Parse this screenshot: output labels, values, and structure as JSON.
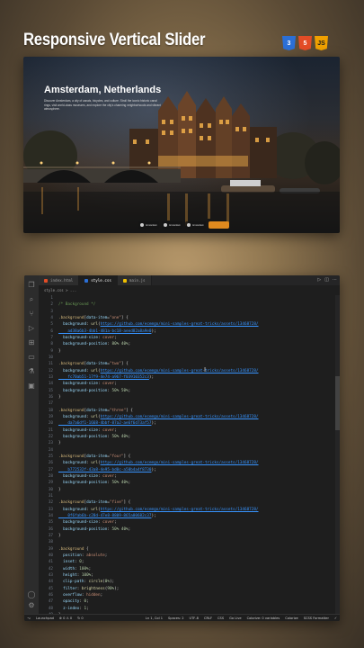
{
  "header": {
    "title": "Responsive Vertical Slider",
    "badges": [
      {
        "label": "3",
        "icon": "css3-logo-icon",
        "color": "#2b6fd6"
      },
      {
        "label": "5",
        "icon": "html5-logo-icon",
        "color": "#e34c26"
      },
      {
        "label": "JS",
        "icon": "javascript-logo-icon",
        "color": "#f0a000"
      }
    ]
  },
  "preview": {
    "title": "Amsterdam, Netherlands",
    "description": "Discover Amsterdam, a city of canals, bicycles, and culture. Stroll the iconic historic canal rings, visit world-class museums, and explore the city's charming neighborhoods and vibrant atmosphere.",
    "thumbs": [
      {
        "label": "Amsterdam"
      },
      {
        "label": "Amsterdam"
      },
      {
        "label": "Amsterdam"
      },
      {
        "label": ""
      }
    ]
  },
  "editor": {
    "tabs": [
      {
        "label": "index.html",
        "color": "#e34c26",
        "active": false
      },
      {
        "label": "style.css",
        "color": "#2b6fd6",
        "active": true
      },
      {
        "label": "main.js",
        "color": "#f0c000",
        "active": false
      }
    ],
    "breadcrumb": "style.css > ...",
    "start_line": 1,
    "lines": [
      [],
      [
        [
          "c-comment",
          "/* Background */"
        ]
      ],
      [],
      [
        [
          "c-sel",
          ".background"
        ],
        [
          "c-brace",
          "["
        ],
        [
          "c-attr",
          "data-item"
        ],
        [
          "c-brace",
          "="
        ],
        [
          "c-str",
          "\"one\""
        ],
        [
          "c-brace",
          "] {"
        ]
      ],
      [
        [
          "c-prop",
          "  background"
        ],
        [
          "txt",
          ": "
        ],
        [
          "c-fn",
          "url"
        ],
        [
          "txt",
          "("
        ],
        [
          "c-link",
          "https://github.com/ecemgo/mini-samples-great-tricks/assets/13468728/"
        ]
      ],
      [
        [
          "c-link",
          "    ad38a6b3-4bb1-481a-bc18-aeed82a8a9e0"
        ],
        [
          "txt",
          ");"
        ]
      ],
      [
        [
          "c-prop",
          "  background-size"
        ],
        [
          "txt",
          ": "
        ],
        [
          "c-val",
          "cover"
        ],
        [
          "txt",
          ";"
        ]
      ],
      [
        [
          "c-prop",
          "  background-position"
        ],
        [
          "txt",
          ": "
        ],
        [
          "c-num",
          "80% 40%"
        ],
        [
          "txt",
          ";"
        ]
      ],
      [
        [
          "c-brace",
          "}"
        ]
      ],
      [],
      [
        [
          "c-sel",
          ".background"
        ],
        [
          "c-brace",
          "["
        ],
        [
          "c-attr",
          "data-item"
        ],
        [
          "c-brace",
          "="
        ],
        [
          "c-str",
          "\"two\""
        ],
        [
          "c-brace",
          "] {"
        ]
      ],
      [
        [
          "c-prop",
          "  background"
        ],
        [
          "txt",
          ": "
        ],
        [
          "c-fn",
          "url"
        ],
        [
          "txt",
          "("
        ],
        [
          "c-link",
          "https://github.com/ecemgo/mini-samples-great-tricks/assets/13468728/"
        ]
      ],
      [
        [
          "c-link",
          "    fc70ab51-17f9-4e74-a967-f03910352c3"
        ],
        [
          "txt",
          ");"
        ]
      ],
      [
        [
          "c-prop",
          "  background-size"
        ],
        [
          "txt",
          ": "
        ],
        [
          "c-val",
          "cover"
        ],
        [
          "txt",
          ";"
        ]
      ],
      [
        [
          "c-prop",
          "  background-position"
        ],
        [
          "txt",
          ": "
        ],
        [
          "c-num",
          "50% 50%"
        ],
        [
          "txt",
          ";"
        ]
      ],
      [
        [
          "c-brace",
          "}"
        ]
      ],
      [],
      [
        [
          "c-sel",
          ".background"
        ],
        [
          "c-brace",
          "["
        ],
        [
          "c-attr",
          "data-item"
        ],
        [
          "c-brace",
          "="
        ],
        [
          "c-str",
          "\"three\""
        ],
        [
          "c-brace",
          "] {"
        ]
      ],
      [
        [
          "c-prop",
          "  background"
        ],
        [
          "txt",
          ": "
        ],
        [
          "c-fn",
          "url"
        ],
        [
          "txt",
          "("
        ],
        [
          "c-link",
          "https://github.com/ecemgo/mini-samples-great-tricks/assets/13468728/"
        ]
      ],
      [
        [
          "c-link",
          "    da7a6df1-1668-4bbf-87a2-ae6f6d73af57"
        ],
        [
          "txt",
          ");"
        ]
      ],
      [
        [
          "c-prop",
          "  background-size"
        ],
        [
          "txt",
          ": "
        ],
        [
          "c-val",
          "cover"
        ],
        [
          "txt",
          ";"
        ]
      ],
      [
        [
          "c-prop",
          "  background-position"
        ],
        [
          "txt",
          ": "
        ],
        [
          "c-num",
          "50% 40%"
        ],
        [
          "txt",
          ";"
        ]
      ],
      [
        [
          "c-brace",
          "}"
        ]
      ],
      [],
      [
        [
          "c-sel",
          ".background"
        ],
        [
          "c-brace",
          "["
        ],
        [
          "c-attr",
          "data-item"
        ],
        [
          "c-brace",
          "="
        ],
        [
          "c-str",
          "\"four\""
        ],
        [
          "c-brace",
          "] {"
        ]
      ],
      [
        [
          "c-prop",
          "  background"
        ],
        [
          "txt",
          ": "
        ],
        [
          "c-fn",
          "url"
        ],
        [
          "txt",
          "("
        ],
        [
          "c-link",
          "https://github.com/ecemgo/mini-samples-great-tricks/assets/13468728/"
        ]
      ],
      [
        [
          "c-link",
          "    b772532f-43a8-4e95-bd0c-a50b4a4f8730"
        ],
        [
          "txt",
          ");"
        ]
      ],
      [
        [
          "c-prop",
          "  background-size"
        ],
        [
          "txt",
          ": "
        ],
        [
          "c-val",
          "cover"
        ],
        [
          "txt",
          ";"
        ]
      ],
      [
        [
          "c-prop",
          "  background-position"
        ],
        [
          "txt",
          ": "
        ],
        [
          "c-num",
          "50% 40%"
        ],
        [
          "txt",
          ";"
        ]
      ],
      [
        [
          "c-brace",
          "}"
        ]
      ],
      [],
      [
        [
          "c-sel",
          ".background"
        ],
        [
          "c-brace",
          "["
        ],
        [
          "c-attr",
          "data-item"
        ],
        [
          "c-brace",
          "="
        ],
        [
          "c-str",
          "\"five\""
        ],
        [
          "c-brace",
          "] {"
        ]
      ],
      [
        [
          "c-prop",
          "  background"
        ],
        [
          "txt",
          ": "
        ],
        [
          "c-fn",
          "url"
        ],
        [
          "txt",
          "("
        ],
        [
          "c-link",
          "https://github.com/ecemgo/mini-samples-great-tricks/assets/13468728/"
        ]
      ],
      [
        [
          "c-link",
          "    0f6fab6b-c28d-47e8-8809-865a00682c37"
        ],
        [
          "txt",
          ");"
        ]
      ],
      [
        [
          "c-prop",
          "  background-size"
        ],
        [
          "txt",
          ": "
        ],
        [
          "c-val",
          "cover"
        ],
        [
          "txt",
          ";"
        ]
      ],
      [
        [
          "c-prop",
          "  background-position"
        ],
        [
          "txt",
          ": "
        ],
        [
          "c-num",
          "50% 40%"
        ],
        [
          "txt",
          ";"
        ]
      ],
      [
        [
          "c-brace",
          "}"
        ]
      ],
      [],
      [
        [
          "c-sel",
          ".background"
        ],
        [
          "c-brace",
          " {"
        ]
      ],
      [
        [
          "c-prop",
          "  position"
        ],
        [
          "txt",
          ": "
        ],
        [
          "c-val",
          "absolute"
        ],
        [
          "txt",
          ";"
        ]
      ],
      [
        [
          "c-prop",
          "  inset"
        ],
        [
          "txt",
          ": "
        ],
        [
          "c-num",
          "0"
        ],
        [
          "txt",
          ";"
        ]
      ],
      [
        [
          "c-prop",
          "  width"
        ],
        [
          "txt",
          ": "
        ],
        [
          "c-num",
          "100%"
        ],
        [
          "txt",
          ";"
        ]
      ],
      [
        [
          "c-prop",
          "  height"
        ],
        [
          "txt",
          ": "
        ],
        [
          "c-num",
          "100%"
        ],
        [
          "txt",
          ";"
        ]
      ],
      [
        [
          "c-prop",
          "  clip-path"
        ],
        [
          "txt",
          ": "
        ],
        [
          "c-fn",
          "circle"
        ],
        [
          "txt",
          "("
        ],
        [
          "c-num",
          "0%"
        ],
        [
          "txt",
          ");"
        ]
      ],
      [
        [
          "c-prop",
          "  filter"
        ],
        [
          "txt",
          ": "
        ],
        [
          "c-fn",
          "brightness"
        ],
        [
          "txt",
          "("
        ],
        [
          "c-num",
          "90%"
        ],
        [
          "txt",
          ");"
        ]
      ],
      [
        [
          "c-prop",
          "  overflow"
        ],
        [
          "txt",
          ": "
        ],
        [
          "c-val",
          "hidden"
        ],
        [
          "txt",
          ";"
        ]
      ],
      [
        [
          "c-prop",
          "  opacity"
        ],
        [
          "txt",
          ": "
        ],
        [
          "c-num",
          "0"
        ],
        [
          "txt",
          ";"
        ]
      ],
      [
        [
          "c-prop",
          "  z-index"
        ],
        [
          "txt",
          ": "
        ],
        [
          "c-num",
          "1"
        ],
        [
          "txt",
          ";"
        ]
      ],
      [
        [
          "c-brace",
          "}"
        ]
      ],
      [],
      [
        [
          "c-sel",
          ".animation"
        ],
        [
          "c-brace",
          " {"
        ]
      ],
      [
        [
          "c-prop",
          "  animation"
        ],
        [
          "txt",
          ": "
        ],
        [
          "c-val",
          "resizeClipPath 3s ease-in-out forwards"
        ],
        [
          "txt",
          ";"
        ]
      ]
    ],
    "status": {
      "left": [
        "⌥",
        "Launchpad",
        "⊗ 0 ⚠ 0",
        "↻ 0"
      ],
      "right": [
        "Ln 1, Col 1",
        "Spaces: 2",
        "UTF-8",
        "CRLF",
        "CSS",
        "Go Live",
        "Colorize: 0 variables",
        "Colorize",
        "SCSS Formatter",
        "✓"
      ]
    }
  }
}
